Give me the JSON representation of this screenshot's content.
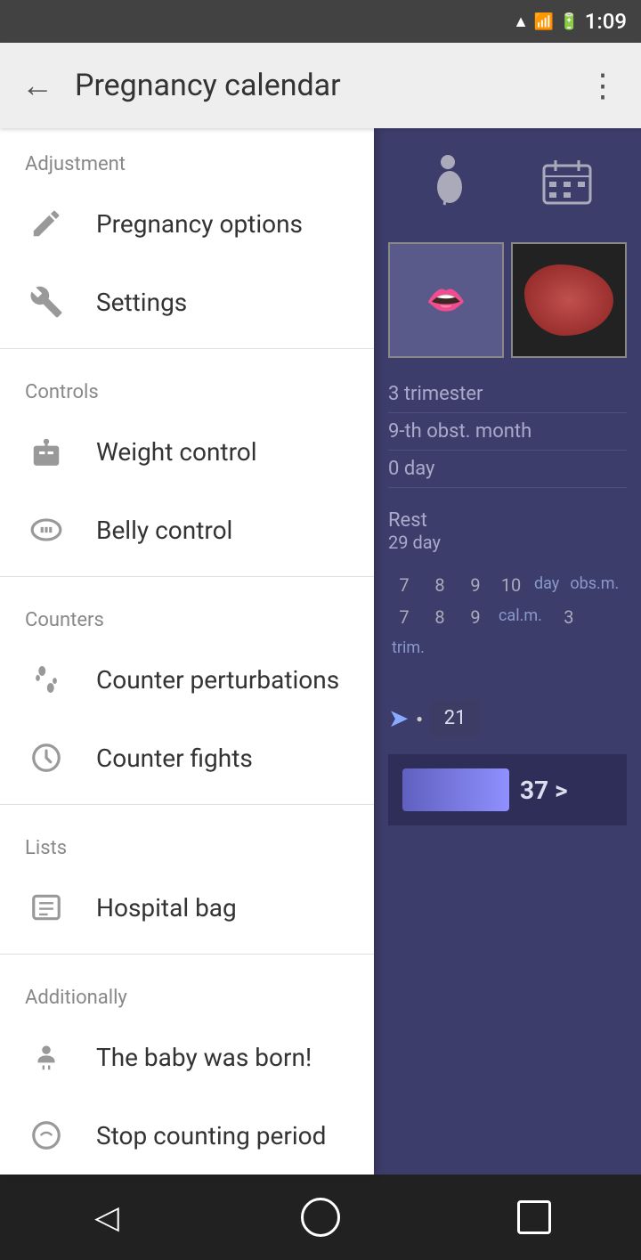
{
  "statusBar": {
    "time": "1:09",
    "icons": [
      "wifi",
      "signal",
      "battery"
    ]
  },
  "toolbar": {
    "backLabel": "←",
    "title": "Pregnancy calendar",
    "moreLabel": "⋮"
  },
  "drawer": {
    "sections": [
      {
        "header": "Adjustment",
        "items": [
          {
            "id": "pregnancy-options",
            "icon": "pen",
            "label": "Pregnancy options"
          },
          {
            "id": "settings",
            "icon": "wrench",
            "label": "Settings"
          }
        ]
      },
      {
        "header": "Controls",
        "items": [
          {
            "id": "weight-control",
            "icon": "scale",
            "label": "Weight control"
          },
          {
            "id": "belly-control",
            "icon": "tape",
            "label": "Belly control"
          }
        ]
      },
      {
        "header": "Counters",
        "items": [
          {
            "id": "counter-perturbations",
            "icon": "footprint",
            "label": "Counter perturbations"
          },
          {
            "id": "counter-fights",
            "icon": "clock",
            "label": "Counter fights"
          }
        ]
      },
      {
        "header": "Lists",
        "items": [
          {
            "id": "hospital-bag",
            "icon": "list",
            "label": "Hospital bag"
          }
        ]
      },
      {
        "header": "Additionally",
        "items": [
          {
            "id": "baby-born",
            "icon": "baby",
            "label": "The baby was born!"
          },
          {
            "id": "stop-counting",
            "icon": "stop-circle",
            "label": "Stop counting period"
          }
        ]
      }
    ]
  },
  "rightPanel": {
    "trimester": "3 trimester",
    "obstMonth": "9-th obst. month",
    "day": "0 day",
    "restLabel": "Rest",
    "restDays": "29 day",
    "calNumbers": [
      "7",
      "8",
      "9",
      "10",
      "7",
      "8",
      "9",
      "3"
    ],
    "dayLabel": "day",
    "obsLabel": "obs.m.",
    "calLabel": "cal.m.",
    "trimLabel": "trim.",
    "badge21": "21",
    "badge37": "37 >"
  },
  "navBar": {
    "backIcon": "◁",
    "homeIcon": "○",
    "recentIcon": "□"
  }
}
